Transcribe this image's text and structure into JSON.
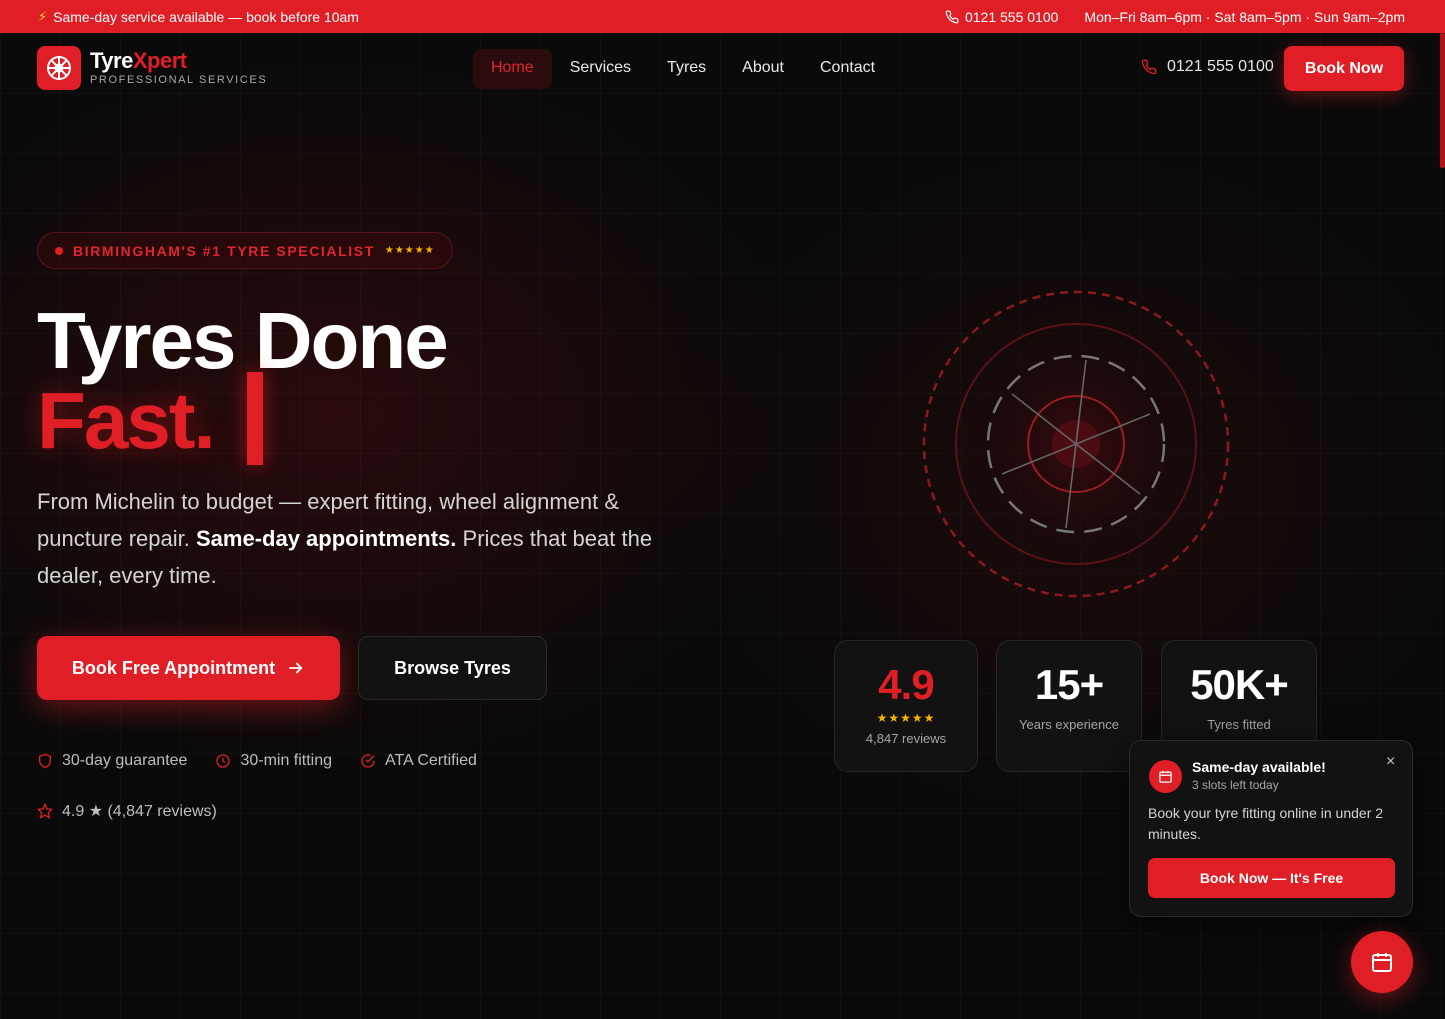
{
  "topbar": {
    "announcement": "Same-day service available — book before 10am",
    "phone": "0121 555 0100",
    "hours": "Mon–Fri 8am–6pm · Sat 8am–5pm · Sun 9am–2pm"
  },
  "brand": {
    "name_part1": "Tyre",
    "name_part2": "Xpert",
    "tagline": "PROFESSIONAL SERVICES",
    "accent_color": "#e01e26"
  },
  "nav": {
    "links": [
      "Home",
      "Services",
      "Tyres",
      "About",
      "Contact"
    ],
    "active": "Home",
    "phone": "0121 555 0100",
    "book_label": "Book Now"
  },
  "hero": {
    "badge": "BIRMINGHAM'S #1 TYRE SPECIALIST",
    "badge_stars": "★★★★★",
    "headline_line1": "Tyres Done",
    "headline_line2": "Fast.",
    "lead_part1": "From Michelin to budget — expert fitting, wheel alignment & puncture repair.",
    "lead_bold": "Same-day appointments.",
    "lead_part2": "Prices that beat the dealer, every time.",
    "primary_cta": "Book Free Appointment",
    "secondary_cta": "Browse Tyres",
    "trust": [
      "30-day guarantee",
      "30-min fitting",
      "ATA Certified"
    ],
    "rating_line": "4.9 ★ (4,847 reviews)"
  },
  "stats": [
    {
      "value": "4.9",
      "stars": "★★★★★",
      "label": "4,847 reviews"
    },
    {
      "value": "15+",
      "label": "Years experience"
    },
    {
      "value": "50K+",
      "label": "Tyres fitted"
    }
  ],
  "popup": {
    "title": "Same-day available!",
    "subtitle": "3 slots left today",
    "close": "×",
    "body": "Book your tyre fitting online in under 2 minutes.",
    "cta": "Book Now — It's Free"
  }
}
